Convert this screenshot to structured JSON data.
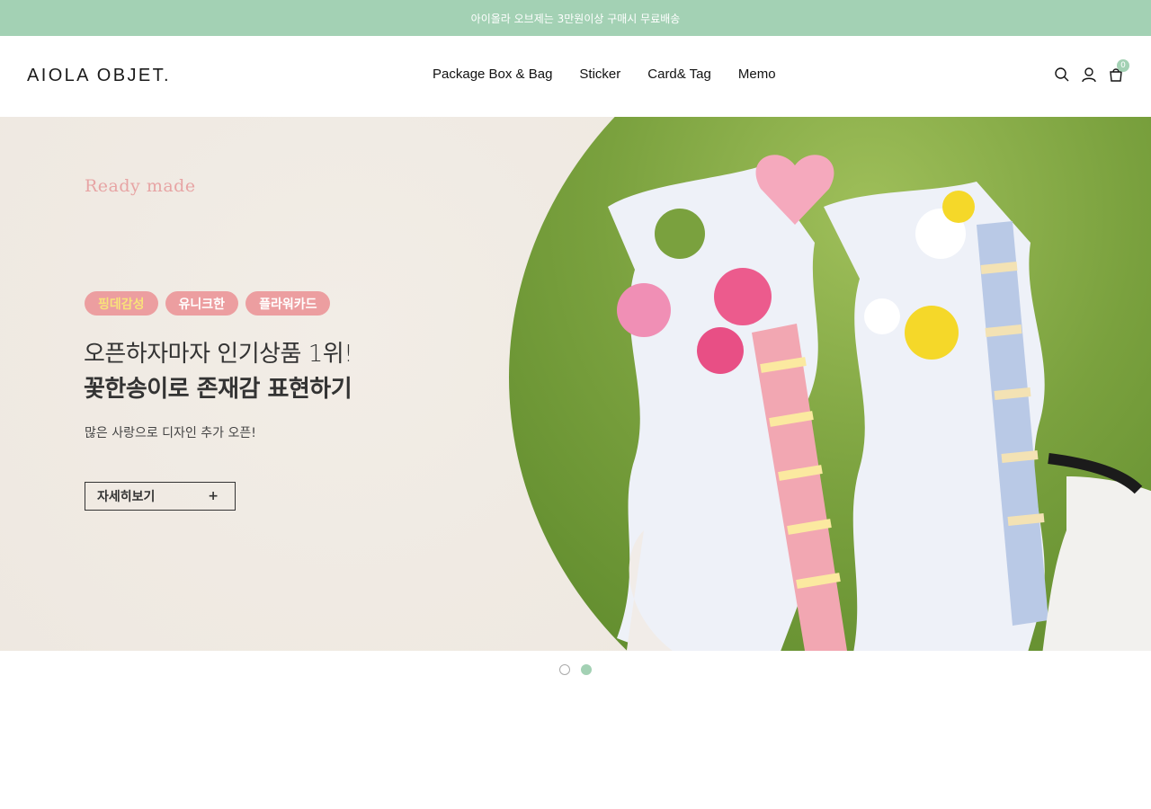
{
  "announcement": "아이올라 오브제는 3만원이상 구매시 무료배송",
  "logo": "AIOLA OBJET.",
  "nav": [
    "Package Box & Bag",
    "Sticker",
    "Card& Tag",
    "Memo"
  ],
  "header_icons": [
    "search-icon",
    "user-icon",
    "cart-icon"
  ],
  "cart_count": "0",
  "hero": {
    "eyebrow": "Ready made",
    "tags": [
      "핑데감성",
      "유니크한",
      "플라워카드"
    ],
    "headline_line1": "오픈하자마자 인기상품 1위!",
    "headline_line2": "꽃한송이로 존재감 표현하기",
    "description": "많은 사랑으로 디자인 추가 오픈!",
    "cta_label": "자세히보기",
    "cta_icon": "+"
  },
  "carousel": {
    "total": 2,
    "active": 2
  },
  "colors": {
    "accent": "#a3d1b4",
    "tag_pink": "#ec9ea0",
    "eyebrow_pink": "#e7a4a4"
  }
}
